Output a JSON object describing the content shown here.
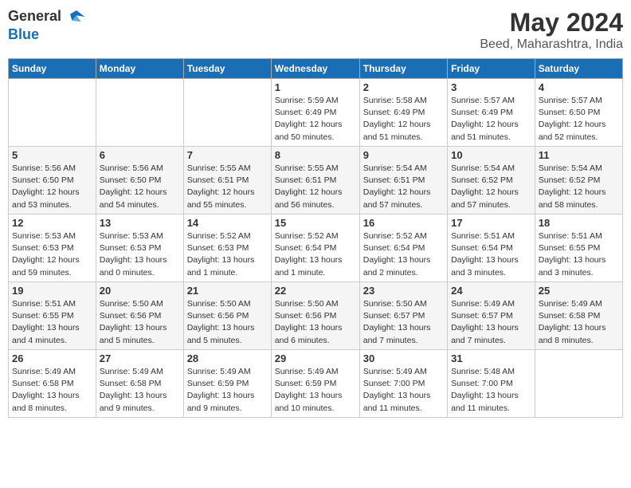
{
  "logo": {
    "text_general": "General",
    "text_blue": "Blue"
  },
  "title": {
    "month_year": "May 2024",
    "location": "Beed, Maharashtra, India"
  },
  "headers": [
    "Sunday",
    "Monday",
    "Tuesday",
    "Wednesday",
    "Thursday",
    "Friday",
    "Saturday"
  ],
  "weeks": [
    [
      {
        "day": "",
        "info": ""
      },
      {
        "day": "",
        "info": ""
      },
      {
        "day": "",
        "info": ""
      },
      {
        "day": "1",
        "info": "Sunrise: 5:59 AM\nSunset: 6:49 PM\nDaylight: 12 hours\nand 50 minutes."
      },
      {
        "day": "2",
        "info": "Sunrise: 5:58 AM\nSunset: 6:49 PM\nDaylight: 12 hours\nand 51 minutes."
      },
      {
        "day": "3",
        "info": "Sunrise: 5:57 AM\nSunset: 6:49 PM\nDaylight: 12 hours\nand 51 minutes."
      },
      {
        "day": "4",
        "info": "Sunrise: 5:57 AM\nSunset: 6:50 PM\nDaylight: 12 hours\nand 52 minutes."
      }
    ],
    [
      {
        "day": "5",
        "info": "Sunrise: 5:56 AM\nSunset: 6:50 PM\nDaylight: 12 hours\nand 53 minutes."
      },
      {
        "day": "6",
        "info": "Sunrise: 5:56 AM\nSunset: 6:50 PM\nDaylight: 12 hours\nand 54 minutes."
      },
      {
        "day": "7",
        "info": "Sunrise: 5:55 AM\nSunset: 6:51 PM\nDaylight: 12 hours\nand 55 minutes."
      },
      {
        "day": "8",
        "info": "Sunrise: 5:55 AM\nSunset: 6:51 PM\nDaylight: 12 hours\nand 56 minutes."
      },
      {
        "day": "9",
        "info": "Sunrise: 5:54 AM\nSunset: 6:51 PM\nDaylight: 12 hours\nand 57 minutes."
      },
      {
        "day": "10",
        "info": "Sunrise: 5:54 AM\nSunset: 6:52 PM\nDaylight: 12 hours\nand 57 minutes."
      },
      {
        "day": "11",
        "info": "Sunrise: 5:54 AM\nSunset: 6:52 PM\nDaylight: 12 hours\nand 58 minutes."
      }
    ],
    [
      {
        "day": "12",
        "info": "Sunrise: 5:53 AM\nSunset: 6:53 PM\nDaylight: 12 hours\nand 59 minutes."
      },
      {
        "day": "13",
        "info": "Sunrise: 5:53 AM\nSunset: 6:53 PM\nDaylight: 13 hours\nand 0 minutes."
      },
      {
        "day": "14",
        "info": "Sunrise: 5:52 AM\nSunset: 6:53 PM\nDaylight: 13 hours\nand 1 minute."
      },
      {
        "day": "15",
        "info": "Sunrise: 5:52 AM\nSunset: 6:54 PM\nDaylight: 13 hours\nand 1 minute."
      },
      {
        "day": "16",
        "info": "Sunrise: 5:52 AM\nSunset: 6:54 PM\nDaylight: 13 hours\nand 2 minutes."
      },
      {
        "day": "17",
        "info": "Sunrise: 5:51 AM\nSunset: 6:54 PM\nDaylight: 13 hours\nand 3 minutes."
      },
      {
        "day": "18",
        "info": "Sunrise: 5:51 AM\nSunset: 6:55 PM\nDaylight: 13 hours\nand 3 minutes."
      }
    ],
    [
      {
        "day": "19",
        "info": "Sunrise: 5:51 AM\nSunset: 6:55 PM\nDaylight: 13 hours\nand 4 minutes."
      },
      {
        "day": "20",
        "info": "Sunrise: 5:50 AM\nSunset: 6:56 PM\nDaylight: 13 hours\nand 5 minutes."
      },
      {
        "day": "21",
        "info": "Sunrise: 5:50 AM\nSunset: 6:56 PM\nDaylight: 13 hours\nand 5 minutes."
      },
      {
        "day": "22",
        "info": "Sunrise: 5:50 AM\nSunset: 6:56 PM\nDaylight: 13 hours\nand 6 minutes."
      },
      {
        "day": "23",
        "info": "Sunrise: 5:50 AM\nSunset: 6:57 PM\nDaylight: 13 hours\nand 7 minutes."
      },
      {
        "day": "24",
        "info": "Sunrise: 5:49 AM\nSunset: 6:57 PM\nDaylight: 13 hours\nand 7 minutes."
      },
      {
        "day": "25",
        "info": "Sunrise: 5:49 AM\nSunset: 6:58 PM\nDaylight: 13 hours\nand 8 minutes."
      }
    ],
    [
      {
        "day": "26",
        "info": "Sunrise: 5:49 AM\nSunset: 6:58 PM\nDaylight: 13 hours\nand 8 minutes."
      },
      {
        "day": "27",
        "info": "Sunrise: 5:49 AM\nSunset: 6:58 PM\nDaylight: 13 hours\nand 9 minutes."
      },
      {
        "day": "28",
        "info": "Sunrise: 5:49 AM\nSunset: 6:59 PM\nDaylight: 13 hours\nand 9 minutes."
      },
      {
        "day": "29",
        "info": "Sunrise: 5:49 AM\nSunset: 6:59 PM\nDaylight: 13 hours\nand 10 minutes."
      },
      {
        "day": "30",
        "info": "Sunrise: 5:49 AM\nSunset: 7:00 PM\nDaylight: 13 hours\nand 11 minutes."
      },
      {
        "day": "31",
        "info": "Sunrise: 5:48 AM\nSunset: 7:00 PM\nDaylight: 13 hours\nand 11 minutes."
      },
      {
        "day": "",
        "info": ""
      }
    ]
  ]
}
